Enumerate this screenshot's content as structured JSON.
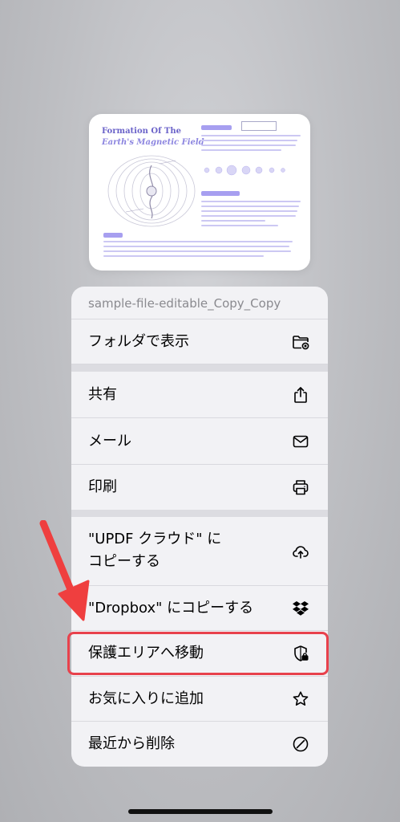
{
  "preview": {
    "title": "Formation Of The",
    "subtitle": "Earth's Magnetic Field"
  },
  "sheet": {
    "header": "sample-file-editable_Copy_Copy",
    "items": [
      {
        "label": "フォルダで表示",
        "icon": "folder-icon"
      },
      {
        "label": "共有",
        "icon": "share-icon"
      },
      {
        "label": "メール",
        "icon": "mail-icon"
      },
      {
        "label": "印刷",
        "icon": "printer-icon"
      },
      {
        "label": "\"UPDF クラウド\" に",
        "label2": "コピーする",
        "icon": "cloud-upload-icon"
      },
      {
        "label": "\"Dropbox\" にコピーする",
        "icon": "dropbox-icon"
      },
      {
        "label": "保護エリアへ移動",
        "icon": "shield-lock-icon"
      },
      {
        "label": "お気に入りに追加",
        "icon": "star-icon"
      },
      {
        "label": "最近から削除",
        "icon": "remove-circle-icon"
      }
    ]
  },
  "colors": {
    "highlight": "#e8414c",
    "accent": "#6b63c9"
  }
}
